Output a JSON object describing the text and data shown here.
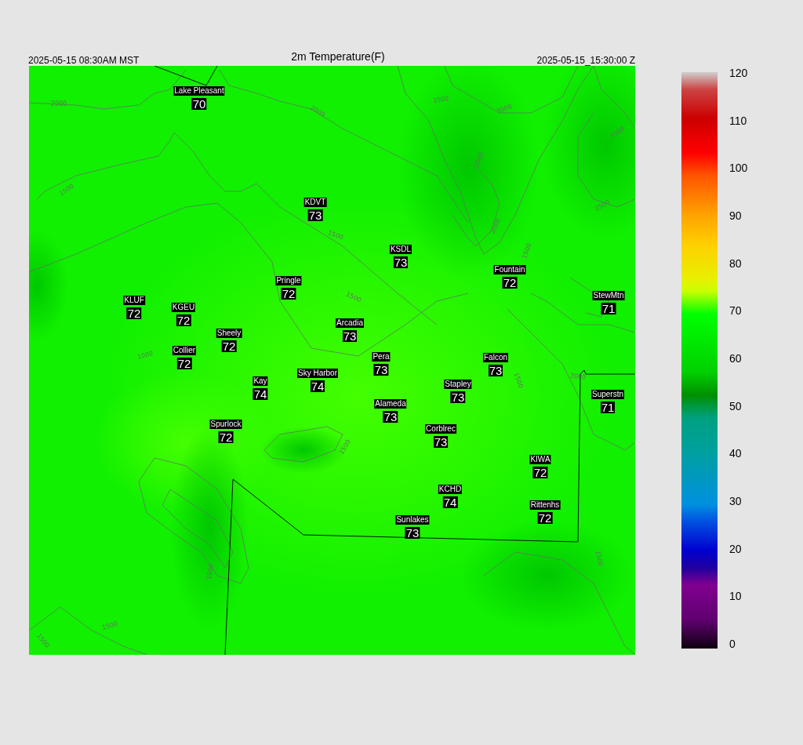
{
  "header": {
    "valid_local": "2025-05-15 08:30AM MST",
    "title": "2m Temperature(F)",
    "valid_utc": "2025-05-15_15:30:00 Z"
  },
  "map": {
    "contour_labels": [
      "2000",
      "2000",
      "3500",
      "3000",
      "2500",
      "3500",
      "2500",
      "2000",
      "1500",
      "1500",
      "1500",
      "1500",
      "1000",
      "2000",
      "1500",
      "1500",
      "1500",
      "1500",
      "1500",
      "1500"
    ],
    "stations": [
      {
        "name": "Lake Pleasant",
        "value": "70"
      },
      {
        "name": "KDVT",
        "value": "73"
      },
      {
        "name": "KSDL",
        "value": "73"
      },
      {
        "name": "Fountain",
        "value": "72"
      },
      {
        "name": "Pringle",
        "value": "72"
      },
      {
        "name": "StewMtn",
        "value": "71"
      },
      {
        "name": "KLUF",
        "value": "72"
      },
      {
        "name": "KGEU",
        "value": "72"
      },
      {
        "name": "Arcadia",
        "value": "73"
      },
      {
        "name": "Sheely",
        "value": "72"
      },
      {
        "name": "Collier",
        "value": "72"
      },
      {
        "name": "Pera",
        "value": "73"
      },
      {
        "name": "Falcon",
        "value": "73"
      },
      {
        "name": "Sky Harbor",
        "value": "74"
      },
      {
        "name": "Kay",
        "value": "74"
      },
      {
        "name": "Stapley",
        "value": "73"
      },
      {
        "name": "Superstn",
        "value": "71"
      },
      {
        "name": "Alameda",
        "value": "73"
      },
      {
        "name": "Spurlock",
        "value": "72"
      },
      {
        "name": "Corblrec",
        "value": "73"
      },
      {
        "name": "KIWA",
        "value": "72"
      },
      {
        "name": "KCHD",
        "value": "74"
      },
      {
        "name": "Rittenhs",
        "value": "72"
      },
      {
        "name": "Sunlakes",
        "value": "73"
      }
    ]
  },
  "colorbar": {
    "ticks": [
      "120",
      "110",
      "100",
      "90",
      "80",
      "70",
      "60",
      "50",
      "40",
      "30",
      "20",
      "10",
      "0"
    ]
  }
}
